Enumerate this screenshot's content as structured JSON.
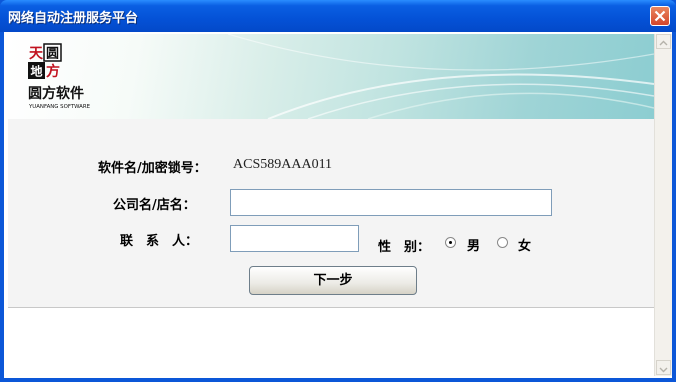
{
  "window": {
    "title": "网络自动注册服务平台"
  },
  "logo": {
    "chars": [
      "天",
      "圆",
      "地",
      "方"
    ],
    "brand": "圆方软件",
    "brand_en": "YUANFANG SOFTWARE"
  },
  "form": {
    "software_label": "软件名/加密锁号：",
    "software_value": "ACS589AAA011",
    "company_label": "公司名/店名：",
    "company_value": "",
    "contact_label": "联　系　人：",
    "contact_value": "",
    "gender_label": "性　别：",
    "gender_options": [
      "男",
      "女"
    ],
    "gender_selected": "男",
    "next_button": "下一步"
  }
}
